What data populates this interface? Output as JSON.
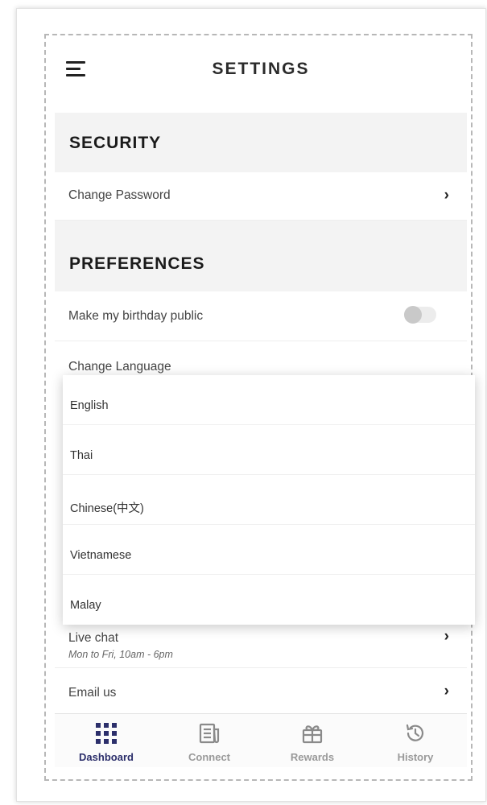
{
  "header": {
    "title": "SETTINGS",
    "menu_icon": "hamburger-icon"
  },
  "security": {
    "heading": "SECURITY",
    "items": [
      {
        "label": "Change Password",
        "icon": "chevron-right-icon"
      }
    ]
  },
  "preferences": {
    "heading": "PREFERENCES",
    "birthday_label": "Make my birthday public",
    "birthday_public": false,
    "language_label": "Change Language"
  },
  "language_dropdown": {
    "options": [
      "English",
      "Thai",
      "Chinese(中文)",
      "Vietnamese",
      "Malay"
    ]
  },
  "support": {
    "live_chat_label": "Live chat",
    "live_chat_hours": "Mon to Fri, 10am - 6pm",
    "email_label": "Email us"
  },
  "tabs": [
    {
      "label": "Dashboard",
      "icon": "grid-icon",
      "active": true
    },
    {
      "label": "Connect",
      "icon": "newspaper-icon",
      "active": false
    },
    {
      "label": "Rewards",
      "icon": "gift-icon",
      "active": false
    },
    {
      "label": "History",
      "icon": "history-icon",
      "active": false
    }
  ],
  "colors": {
    "accent": "#2c2f6b",
    "section_bg": "#f3f3f3",
    "inactive_tab": "#9a9a9a"
  }
}
